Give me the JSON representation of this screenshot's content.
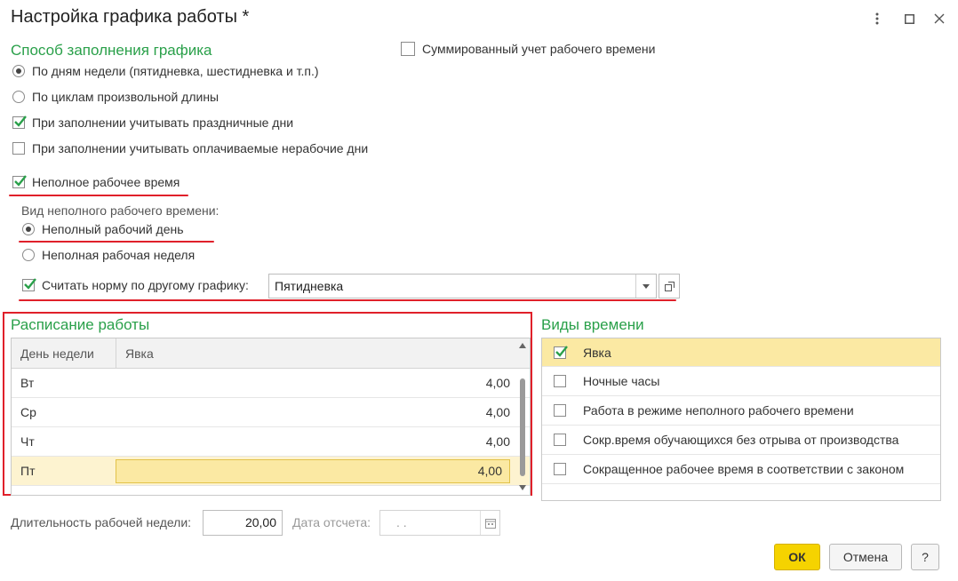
{
  "window": {
    "title": "Настройка графика работы *",
    "controls": [
      "more-icon",
      "maximize-icon",
      "close-icon"
    ]
  },
  "fill": {
    "title": "Способ заполнения графика",
    "radio_week": "По дням недели (пятидневка, шестидневка и т.п.)",
    "radio_cycle": "По циклам произвольной длины",
    "cb_holidays": "При заполнении учитывать праздничные дни",
    "cb_paid_nonwork": "При заполнении учитывать оплачиваемые нерабочие дни",
    "cb_summarized": "Суммированный учет рабочего времени"
  },
  "parttime": {
    "cb_label": "Неполное рабочее время",
    "kind_label": "Вид неполного рабочего времени:",
    "radio_day": "Неполный рабочий день",
    "radio_week": "Неполная рабочая неделя",
    "norm_label": "Считать норму по другому графику:",
    "norm_value": "Пятидневка"
  },
  "schedule": {
    "title": "Расписание работы",
    "columns": [
      "День недели",
      "Явка"
    ],
    "rows": [
      {
        "day": "Вт",
        "value": "4,00"
      },
      {
        "day": "Ср",
        "value": "4,00"
      },
      {
        "day": "Чт",
        "value": "4,00"
      },
      {
        "day": "Пт",
        "value": "4,00"
      }
    ]
  },
  "time_kinds": {
    "title": "Виды времени",
    "items": [
      {
        "label": "Явка",
        "checked": true
      },
      {
        "label": "Ночные часы",
        "checked": false
      },
      {
        "label": "Работа в режиме неполного рабочего времени",
        "checked": false
      },
      {
        "label": "Сокр.время обучающихся без отрыва от производства",
        "checked": false
      },
      {
        "label": "Сокращенное рабочее время в соответствии с законом",
        "checked": false
      }
    ]
  },
  "footer": {
    "week_length_label": "Длительность рабочей недели:",
    "week_length_value": "20,00",
    "ref_date_label": "Дата отсчета:",
    "ref_date_value": " .  .",
    "ok": "ОК",
    "cancel": "Отмена",
    "help": "?"
  },
  "colors": {
    "accent_green": "#2aa04a",
    "highlight_yellow": "#fbe9a3",
    "ok_yellow": "#f5d300",
    "red_markup": "#e0202a"
  }
}
